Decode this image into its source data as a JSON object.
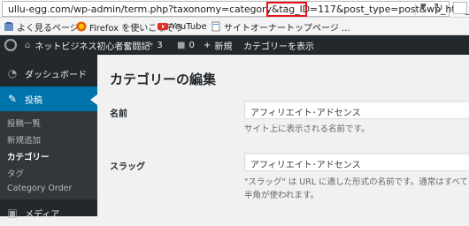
{
  "browser": {
    "url": "ullu-egg.com/wp-admin/term.php?taxonomy=category&tag_ID=117&post_type=post&wp_http_refe",
    "bookmarks": [
      {
        "label": "よく見るページ",
        "icon": "star-icon"
      },
      {
        "label": "Firefox を使いこなそう",
        "icon": "firefox-icon"
      },
      {
        "label": "YouTube",
        "icon": "youtube-icon"
      },
      {
        "label": "サイトオーナートップページ ...",
        "icon": "page-icon"
      }
    ]
  },
  "adminbar": {
    "site_name": "ネットビジネス初心者奮闘記",
    "updates_count": "3",
    "comments_count": "0",
    "new_label": "新規",
    "view_label": "カテゴリーを表示"
  },
  "sidebar": {
    "dashboard": "ダッシュボード",
    "posts": "投稿",
    "submenu": [
      "投稿一覧",
      "新規追加",
      "カテゴリー",
      "タグ",
      "Category Order"
    ],
    "media": "メディア"
  },
  "main": {
    "title": "カテゴリーの編集",
    "name_label": "名前",
    "name_value": "アフィリエイト･アドセンス",
    "name_desc": "サイト上に表示される名前です。",
    "slug_label": "スラッグ",
    "slug_value": "アフィリエイト･アドセンス",
    "slug_desc": "\"スラッグ\" は URL に適した形式の名前です。通常はすべて半角が使われます。"
  },
  "colors": {
    "admin_bar": "#23282d",
    "active_menu": "#0073aa",
    "url_highlight": "#e8121a"
  }
}
